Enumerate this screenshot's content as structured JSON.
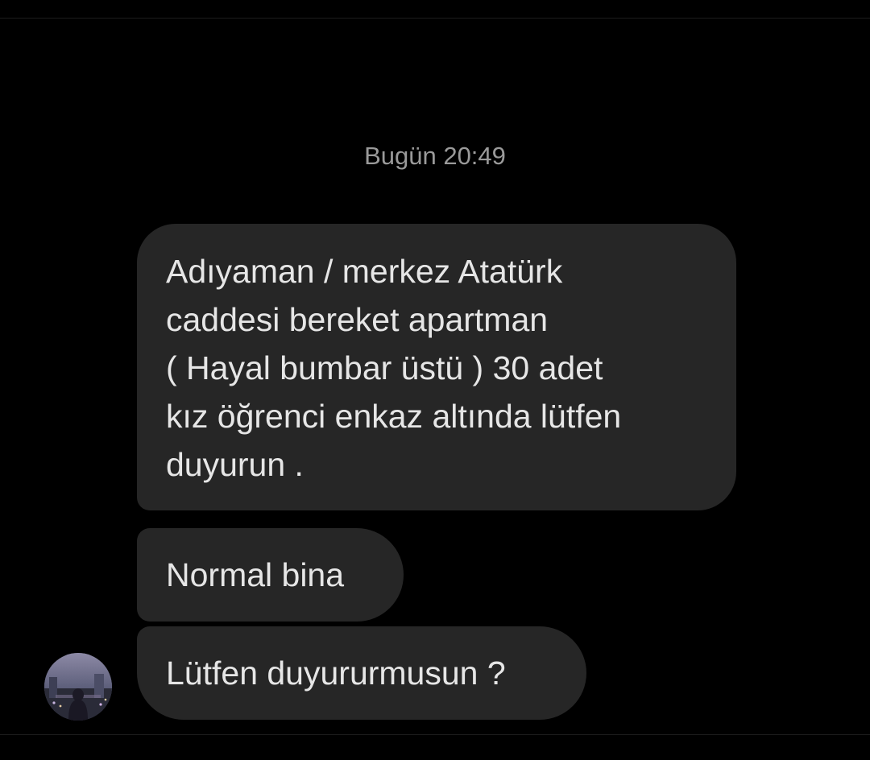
{
  "conversation": {
    "timestamp": "Bugün 20:49",
    "messages": [
      {
        "lines": [
          "Adıyaman / merkez Atatürk",
          "caddesi bereket apartman",
          "( Hayal bumbar üstü ) 30 adet",
          "kız öğrenci enkaz altında lütfen",
          "duyurun ."
        ]
      },
      {
        "text": "Normal bina"
      },
      {
        "text": "Lütfen duyururmusun ?"
      }
    ],
    "sender": {
      "avatar_icon": "profile-photo"
    }
  },
  "colors": {
    "background": "#000000",
    "bubble": "#262626",
    "message_text": "#e6e6e6",
    "timestamp_text": "#9a9a9a"
  }
}
